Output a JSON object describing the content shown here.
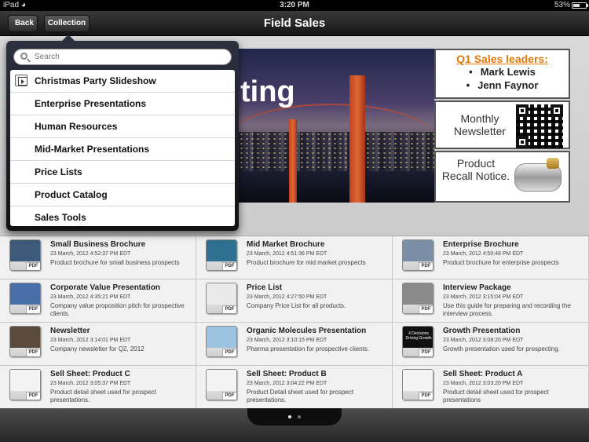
{
  "status": {
    "device": "iPad",
    "time": "3:20 PM",
    "battery": "53%",
    "battery_level": 0.53
  },
  "nav": {
    "title": "Field Sales",
    "back_label": "Back",
    "collection_label": "Collection"
  },
  "popover": {
    "search_placeholder": "Search",
    "items": [
      {
        "label": "Christmas Party Slideshow",
        "icon": "slideshow-icon"
      },
      {
        "label": "Enterprise Presentations"
      },
      {
        "label": "Human Resources"
      },
      {
        "label": "Mid-Market Presentations"
      },
      {
        "label": "Price Lists"
      },
      {
        "label": "Product Catalog"
      },
      {
        "label": "Sales Tools"
      }
    ]
  },
  "banner": {
    "title_text": "ting"
  },
  "panels": {
    "leaders": {
      "heading": "Q1 Sales leaders:",
      "names": [
        "Mark Lewis",
        "Jenn Faynor"
      ]
    },
    "newsletter": {
      "text": "Monthly Newsletter",
      "icon": "qr-code-icon"
    },
    "recall": {
      "text": "Product Recall Notice.",
      "icon": "starter-motor-icon"
    }
  },
  "documents": [
    {
      "name": "Small Business Brochure",
      "date": "23 March, 2012 4:52:37 PM EDT",
      "desc": "Product brochure for small business prospects",
      "badge": "PDF",
      "cover": "#3c5a7a"
    },
    {
      "name": "Mid Market Brochure",
      "date": "23 March, 2012 4:51:36 PM EDT",
      "desc": "Product brochure for mid market prospects",
      "badge": "PDF",
      "cover": "#2f6f8f"
    },
    {
      "name": "Enterprise Brochure",
      "date": "23 March, 2012 4:50:48 PM EDT",
      "desc": "Product brochure for enterprise prospects",
      "badge": "PDF",
      "cover": "#7a8fa6"
    },
    {
      "name": "Corporate Value Presentation",
      "date": "23 March, 2012 4:35:21 PM EDT",
      "desc": "Company value proposition pitch for prospective clients.",
      "badge": "PDF",
      "cover": "#4a6fa8"
    },
    {
      "name": "Price List",
      "date": "23 March, 2012 4:27:50 PM EDT",
      "desc": "Company Price List for all products.",
      "badge": "PDF",
      "cover": "#e9e9e9"
    },
    {
      "name": "Interview Package",
      "date": "23 March, 2012 3:15:04 PM EDT",
      "desc": "Use this guide for preparing and recording the interview process.",
      "badge": "PDF",
      "cover": "#8a8a8a"
    },
    {
      "name": "Newsletter",
      "date": "23 March, 2012 3:14:01 PM EDT",
      "desc": "Company newsletter for Q2, 2012",
      "badge": "PDF",
      "cover": "#5a4a3a"
    },
    {
      "name": "Organic Molecules Presentation",
      "date": "23 March, 2012 3:10:15 PM EDT",
      "desc": "Pharma presentation for prospective clients.",
      "badge": "PDF",
      "cover": "#9cc4e0"
    },
    {
      "name": "Growth Presentation",
      "date": "23 March, 2012 3:08:20 PM EDT",
      "desc": "Growth presentation used for prospecting.",
      "badge": "PDF",
      "cover": "#111111",
      "cover_text": "4 Decisions Driving Growth"
    },
    {
      "name": "Sell Sheet: Product C",
      "date": "23 March, 2012 3:05:37 PM EDT",
      "desc": "Product detail sheet used for prospect presentations.",
      "badge": "PDF",
      "cover": "#f4f4f4"
    },
    {
      "name": "Sell Sheet: Product B",
      "date": "23 March, 2012 3:04:22 PM EDT",
      "desc": "Product Detail sheet used for prospect presentations.",
      "badge": "PDF",
      "cover": "#f4f4f4"
    },
    {
      "name": "Sell Sheet: Product A",
      "date": "23 March, 2012 3:03:20 PM EDT",
      "desc": "Product detail sheet used for prospect presentations",
      "badge": "PDF",
      "cover": "#f4f4f4"
    }
  ],
  "pager": {
    "count": 2,
    "current": 0
  }
}
